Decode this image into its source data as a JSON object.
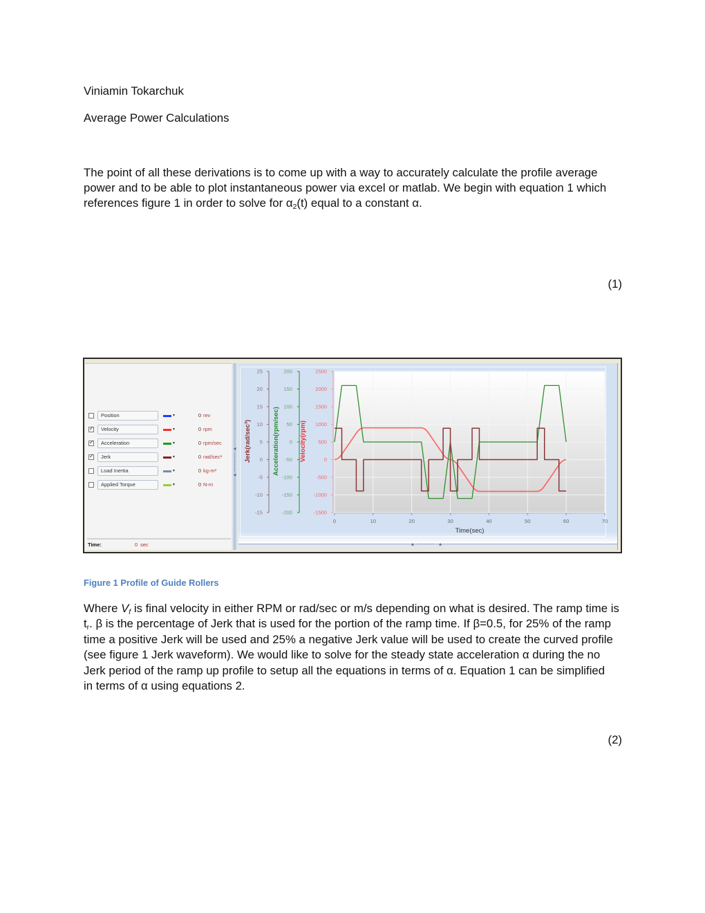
{
  "document": {
    "author": "Viniamin Tokarchuk",
    "title": "Average Power Calculations",
    "paragraph1": {
      "line1": "The point of all these derivations is to come up with a way to accurately calculate the profile average",
      "line2": "power and to be able to plot instantaneous power via excel or matlab. We begin with equation 1 which",
      "line3_pre": "references figure 1 in order to solve for α",
      "line3_sub": "2",
      "line3_post": "(t) equal to a constant α."
    },
    "equation1_number": "(1)",
    "figure_caption": "Figure 1 Profile of Guide Rollers",
    "paragraph2": {
      "line1_pre": "Where ",
      "line1_var": "V",
      "line1_sub": "f",
      "line1_post": " is final velocity in either RPM or rad/sec or m/s depending on what is desired. The ramp time is",
      "line2_var": "t",
      "line2_sub": "r",
      "line2_post": ". β is the percentage of Jerk that is used for the portion of the ramp time. If β=0.5, for 25% of the ramp",
      "line3": "time a positive Jerk will be used and 25% a negative Jerk value will be used to create the curved profile",
      "line4": "(see figure 1 Jerk waveform). We would like to solve for the steady state acceleration α during the no",
      "line5": "Jerk period of the ramp up profile to setup all the equations in terms of α. Equation 1 can be simplified",
      "line6": "in terms of α using equations 2."
    },
    "equation2_number": "(2)"
  },
  "figure": {
    "check_glyph": "✓",
    "dropdown_glyph": "▾",
    "signals": [
      {
        "label": "Position",
        "checked": false,
        "color": "#1f3fff",
        "value": "0",
        "unit": "rev"
      },
      {
        "label": "Velocity",
        "checked": true,
        "color": "#ff2a2a",
        "value": "0",
        "unit": "rpm"
      },
      {
        "label": "Acceleration",
        "checked": true,
        "color": "#1f9a1f",
        "value": "0",
        "unit": "rpm/sec"
      },
      {
        "label": "Jerk",
        "checked": true,
        "color": "#8b1f1f",
        "value": "0",
        "unit": "rad/sec³"
      },
      {
        "label": "Load Inertia",
        "checked": false,
        "color": "#7a8aa0",
        "value": "0",
        "unit": "kg-m²"
      },
      {
        "label": "Applied Torque",
        "checked": false,
        "color": "#9acd32",
        "value": "0",
        "unit": "N-m"
      }
    ],
    "time": {
      "label": "Time:",
      "value": "0",
      "unit": "sec"
    },
    "splitter_arrow_left": "◀",
    "splitter_arrow_up": "▲"
  },
  "chart_data": {
    "type": "line",
    "title": "",
    "xlabel": "Time(sec)",
    "xlim": [
      0,
      70
    ],
    "xticks": [
      0,
      10,
      20,
      30,
      40,
      50,
      60,
      70
    ],
    "grid": true,
    "legend": "left-panel",
    "y_axes": [
      {
        "id": "jerk",
        "label": "Jerk(rad/sec³)",
        "ylim": [
          -15,
          25
        ],
        "ticks": [
          25,
          20,
          15,
          10,
          5,
          0,
          -5,
          -10,
          -15
        ],
        "line_color": "#8c6f6f",
        "tick_color": "#8e7272",
        "title_color": "#8b3232"
      },
      {
        "id": "acceleration",
        "label": "Acceleration(rpm/sec)",
        "ylim": [
          -200,
          200
        ],
        "ticks": [
          200,
          150,
          100,
          50,
          0,
          -50,
          -100,
          -150,
          -200
        ],
        "line_color": "#2a8a2a",
        "tick_color": "#6fa36f",
        "title_color": "#2a8a2a"
      },
      {
        "id": "velocity",
        "label": "Velocity(rpm)",
        "ylim": [
          -1500,
          2500
        ],
        "ticks": [
          2500,
          2000,
          1500,
          1000,
          500,
          0,
          -500,
          -1000,
          -1500
        ],
        "line_color": "#f39a9a",
        "tick_color": "#f06a6a",
        "title_color": "#ee3030"
      }
    ],
    "series": [
      {
        "name": "Velocity",
        "axis": "velocity",
        "unit": "rpm",
        "color": "#ff5252",
        "points": [
          [
            0,
            0
          ],
          [
            0.47,
            9
          ],
          [
            0.94,
            38
          ],
          [
            1.41,
            84
          ],
          [
            1.88,
            150
          ],
          [
            5.63,
            750
          ],
          [
            6.09,
            816
          ],
          [
            6.56,
            863
          ],
          [
            7.03,
            891
          ],
          [
            7.5,
            900
          ],
          [
            22.5,
            900
          ],
          [
            22.97,
            891
          ],
          [
            23.44,
            863
          ],
          [
            23.91,
            816
          ],
          [
            24.38,
            750
          ],
          [
            28.13,
            150
          ],
          [
            28.59,
            84
          ],
          [
            29.06,
            38
          ],
          [
            29.53,
            9
          ],
          [
            30,
            0
          ],
          [
            30.47,
            -9
          ],
          [
            30.94,
            -38
          ],
          [
            31.41,
            -84
          ],
          [
            31.88,
            -150
          ],
          [
            35.63,
            -750
          ],
          [
            36.09,
            -816
          ],
          [
            36.56,
            -863
          ],
          [
            37.03,
            -891
          ],
          [
            37.5,
            -900
          ],
          [
            52.5,
            -900
          ],
          [
            52.97,
            -891
          ],
          [
            53.44,
            -863
          ],
          [
            53.91,
            -816
          ],
          [
            54.38,
            -750
          ],
          [
            58.13,
            -150
          ],
          [
            58.59,
            -84
          ],
          [
            59.06,
            -38
          ],
          [
            59.53,
            -9
          ],
          [
            60,
            0
          ]
        ]
      },
      {
        "name": "Acceleration",
        "axis": "acceleration",
        "unit": "rpm/sec",
        "color": "#2e8f2e",
        "points": [
          [
            0,
            0
          ],
          [
            1.88,
            160
          ],
          [
            5.63,
            160
          ],
          [
            7.5,
            0
          ],
          [
            22.5,
            0
          ],
          [
            24.38,
            -160
          ],
          [
            28.13,
            -160
          ],
          [
            30,
            0
          ],
          [
            31.88,
            -160
          ],
          [
            35.63,
            -160
          ],
          [
            37.5,
            0
          ],
          [
            52.5,
            0
          ],
          [
            54.38,
            160
          ],
          [
            58.13,
            160
          ],
          [
            60,
            0
          ]
        ]
      },
      {
        "name": "Jerk",
        "axis": "jerk",
        "unit": "rad/sec³",
        "color": "#8b3535",
        "points": [
          [
            0,
            8.9
          ],
          [
            1.88,
            8.9
          ],
          [
            1.88,
            0
          ],
          [
            5.63,
            0
          ],
          [
            5.63,
            -8.9
          ],
          [
            7.5,
            -8.9
          ],
          [
            7.5,
            0
          ],
          [
            22.5,
            0
          ],
          [
            22.5,
            -8.9
          ],
          [
            24.38,
            -8.9
          ],
          [
            24.38,
            0
          ],
          [
            28.13,
            0
          ],
          [
            28.13,
            8.9
          ],
          [
            30,
            8.9
          ],
          [
            30,
            -8.9
          ],
          [
            31.88,
            -8.9
          ],
          [
            31.88,
            0
          ],
          [
            35.63,
            0
          ],
          [
            35.63,
            8.9
          ],
          [
            37.5,
            8.9
          ],
          [
            37.5,
            0
          ],
          [
            52.5,
            0
          ],
          [
            52.5,
            8.9
          ],
          [
            54.38,
            8.9
          ],
          [
            54.38,
            0
          ],
          [
            58.13,
            0
          ],
          [
            58.13,
            -8.9
          ],
          [
            60,
            -8.9
          ]
        ]
      }
    ]
  }
}
